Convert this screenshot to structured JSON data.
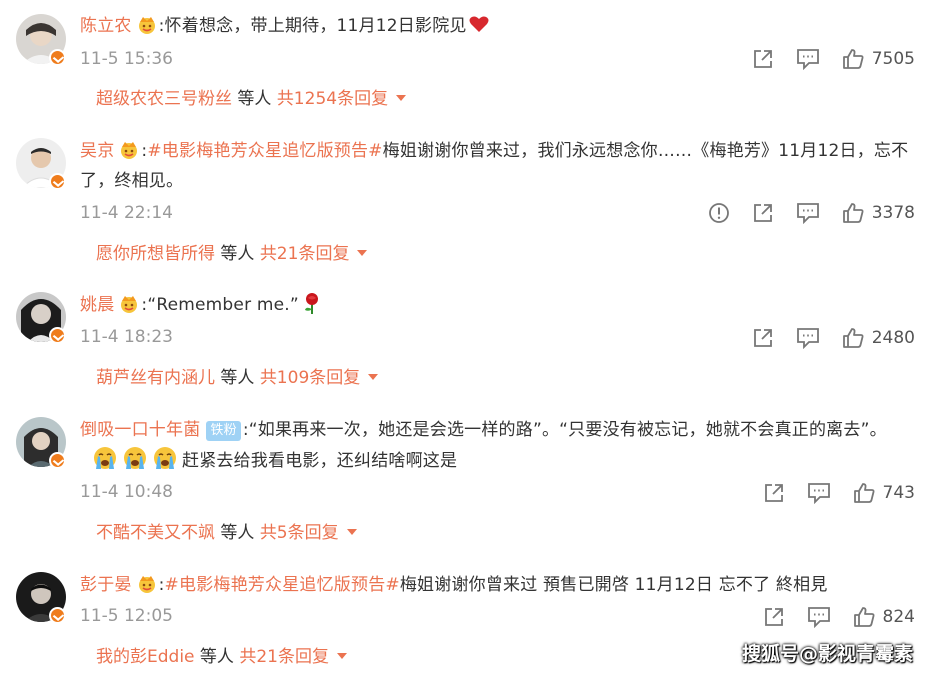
{
  "comments": [
    {
      "name": "陈立农",
      "sep": ":",
      "text": "怀着想念，带上期待，11月12日影院见",
      "emoji": "red-heart-emoji",
      "time": "11-5 15:36",
      "likes": "7505",
      "reply_user": "超级农农三号粉丝",
      "reply_mid": " 等人 ",
      "reply_count": "共1254条回复"
    },
    {
      "name": "吴京",
      "sep": ":",
      "topic": "#电影梅艳芳众星追忆版预告#",
      "text": "梅姐谢谢你曾来过，我们永远想念你……《梅艳芳》11月12日，忘不了，终相见。",
      "time": "11-4 22:14",
      "likes": "3378",
      "reply_user": "愿你所想皆所得",
      "reply_mid": " 等人 ",
      "reply_count": "共21条回复"
    },
    {
      "name": "姚晨",
      "sep": ":",
      "text": "“Remember me.”",
      "emoji": "rose-emoji",
      "time": "11-4 18:23",
      "likes": "2480",
      "reply_user": "葫芦丝有内涵儿",
      "reply_mid": " 等人 ",
      "reply_count": "共109条回复"
    },
    {
      "name": "倒吸一口十年菌",
      "badge": "铁粉",
      "sep": ":",
      "text": "“如果再来一次，她还是会选一样的路”。“只要没有被忘记，她就不会真正的离去”。",
      "emoji": "crying-face-emoji",
      "text2": "赶紧去给我看电影，还纠结啥啊这是",
      "time": "11-4 10:48",
      "likes": "743",
      "reply_user": "不酷不美又不飒",
      "reply_mid": " 等人 ",
      "reply_count": "共5条回复"
    },
    {
      "name": "彭于晏",
      "sep": ":",
      "topic": "#电影梅艳芳众星追忆版预告#",
      "text": "梅姐谢谢你曾来过 預售已開啓 11月12日 忘不了 終相見",
      "time": "11-5 12:05",
      "likes": "824",
      "reply_user": "我的彭Eddie",
      "reply_mid": " 等人 ",
      "reply_count": "共21条回复"
    }
  ],
  "watermark": "搜狐号@影视青霉素",
  "colors": {
    "accent": "#eb7350",
    "muted": "#999999",
    "verified": "#ef7c1c",
    "fan_badge": "#9fd2f5"
  },
  "icons": {
    "share": "share-icon",
    "comment": "comment-icon",
    "like": "like-icon",
    "report": "report-icon",
    "crown": "crown-icon",
    "verified": "verified-badge"
  }
}
